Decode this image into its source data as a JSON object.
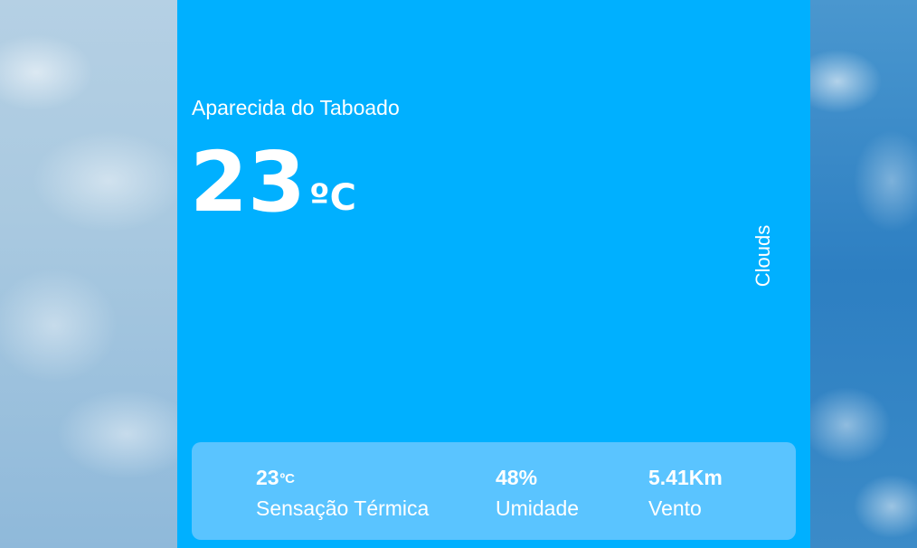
{
  "weather": {
    "city": "Aparecida do Taboado",
    "temperature": "23",
    "temperature_unit": "ºC",
    "condition": "Clouds"
  },
  "details": {
    "feels_like": {
      "value": "23",
      "unit": "ºC",
      "label": "Sensação Térmica"
    },
    "humidity": {
      "value": "48%",
      "label": "Umidade"
    },
    "wind": {
      "value": "5.41Km",
      "label": "Vento"
    }
  },
  "colors": {
    "panel": "#00b0ff",
    "details_card": "#5ac4ff",
    "text": "#ffffff"
  }
}
